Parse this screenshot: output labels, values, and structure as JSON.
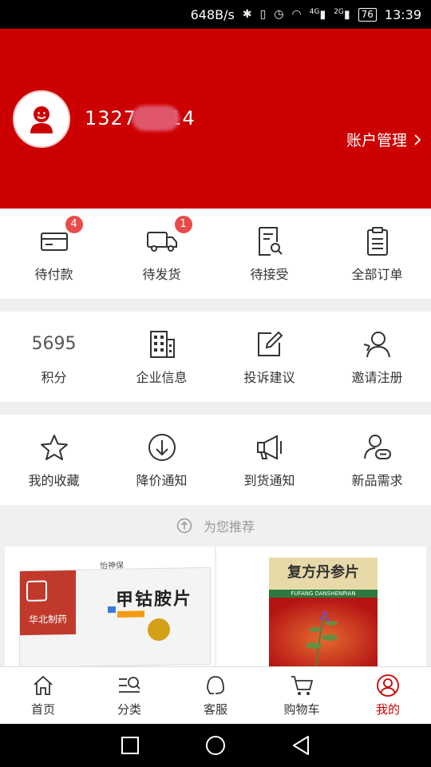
{
  "status": {
    "speed": "648B/s",
    "network": "4G",
    "network2": "2G",
    "battery": "76",
    "time": "13:39"
  },
  "header": {
    "phone": "1327   3214",
    "account_label": "账户管理"
  },
  "orders": [
    {
      "label": "待付款",
      "badge": "4"
    },
    {
      "label": "待发货",
      "badge": "1"
    },
    {
      "label": "待接受",
      "badge": ""
    },
    {
      "label": "全部订单",
      "badge": ""
    }
  ],
  "services": [
    {
      "value": "5695",
      "label": "积分"
    },
    {
      "label": "企业信息"
    },
    {
      "label": "投诉建议"
    },
    {
      "label": "邀请注册"
    }
  ],
  "tools": [
    {
      "label": "我的收藏"
    },
    {
      "label": "降价通知"
    },
    {
      "label": "到货通知"
    },
    {
      "label": "新品需求"
    }
  ],
  "recommend": {
    "title": "为您推荐"
  },
  "products": [
    {
      "brand": "华北制药",
      "name": "甲钴胺片",
      "maker_line": "怡神保"
    },
    {
      "name": "复方丹参片",
      "pinyin": "FUFANG DANSHENPIAN"
    }
  ],
  "tabs": [
    {
      "label": "首页"
    },
    {
      "label": "分类"
    },
    {
      "label": "客服"
    },
    {
      "label": "购物车"
    },
    {
      "label": "我的"
    }
  ],
  "colors": {
    "brand_red": "#cc0000",
    "badge_red": "#e94b4b"
  }
}
